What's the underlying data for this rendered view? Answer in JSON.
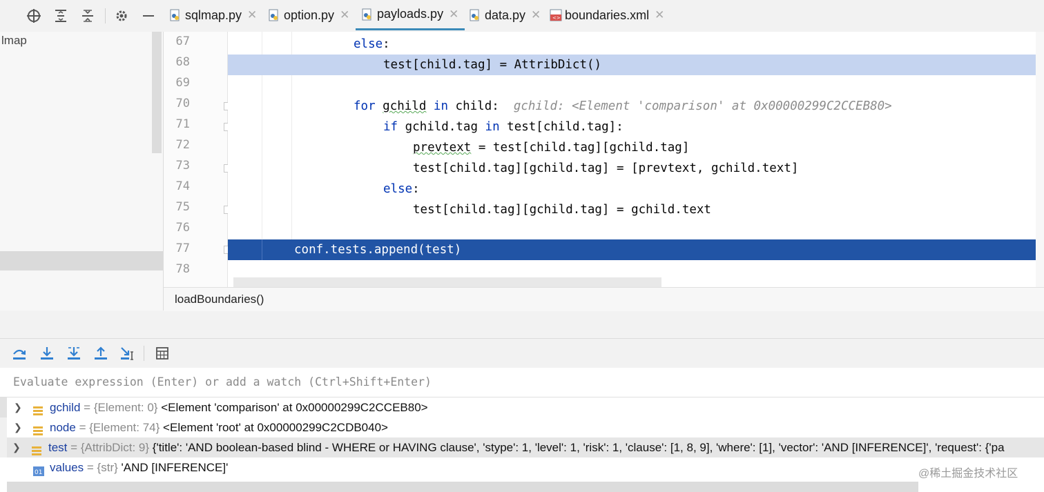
{
  "tabs": [
    {
      "label": "sqlmap.py",
      "icon": "python-file-icon",
      "active": false
    },
    {
      "label": "option.py",
      "icon": "python-file-icon",
      "active": false
    },
    {
      "label": "payloads.py",
      "icon": "python-file-icon",
      "active": true
    },
    {
      "label": "data.py",
      "icon": "python-file-icon",
      "active": false
    },
    {
      "label": "boundaries.xml",
      "icon": "xml-file-icon",
      "active": false
    }
  ],
  "project": {
    "root_label": "lmap"
  },
  "editor": {
    "lines": [
      {
        "num": "67"
      },
      {
        "num": "68"
      },
      {
        "num": "69"
      },
      {
        "num": "70"
      },
      {
        "num": "71"
      },
      {
        "num": "72"
      },
      {
        "num": "73"
      },
      {
        "num": "74"
      },
      {
        "num": "75"
      },
      {
        "num": "76"
      },
      {
        "num": "77"
      },
      {
        "num": "78"
      }
    ],
    "code": {
      "l67_kw": "else",
      "l67_rest": ":",
      "l68": "test[child.tag] = AttribDict()",
      "l70_kw1": "for",
      "l70_var": "gchild",
      "l70_kw2": "in",
      "l70_rest": "child:",
      "l70_hint": "gchild: <Element 'comparison' at 0x00000299C2CCEB80>",
      "l71_kw1": "if",
      "l71_mid": "gchild.tag",
      "l71_kw2": "in",
      "l71_rest": "test[child.tag]:",
      "l72_var": "prevtext",
      "l72_rest": " = test[child.tag][gchild.tag]",
      "l73": "test[child.tag][gchild.tag] = [prevtext, gchild.text]",
      "l74_kw": "else",
      "l74_rest": ":",
      "l75": "test[child.tag][gchild.tag] = gchild.text",
      "l77": "conf.tests.append(test)"
    }
  },
  "breadcrumb": {
    "label": "loadBoundaries()"
  },
  "debug": {
    "toolbar_icons": [
      "step-over-icon",
      "step-into-icon",
      "step-into-my-code-icon",
      "step-out-icon",
      "run-to-cursor-icon",
      "evaluate-expression-icon"
    ],
    "eval_placeholder": "Evaluate expression (Enter) or add a watch (Ctrl+Shift+Enter)"
  },
  "variables": [
    {
      "name": "gchild",
      "type": "{Element: 0}",
      "value": "<Element 'comparison' at 0x00000299C2CCEB80>",
      "icon": "object-icon",
      "expandable": true
    },
    {
      "name": "node",
      "type": "{Element: 74}",
      "value": "<Element 'root' at 0x00000299C2CDB040>",
      "icon": "object-icon",
      "expandable": true
    },
    {
      "name": "test",
      "type": "{AttribDict: 9}",
      "value": "{'title': 'AND boolean-based blind - WHERE or HAVING clause', 'stype': 1, 'level': 1, 'risk': 1, 'clause': [1, 8, 9], 'where': [1], 'vector': 'AND [INFERENCE]', 'request': {'pa",
      "icon": "object-icon",
      "expandable": true,
      "selected": true
    },
    {
      "name": "values",
      "type": "{str}",
      "value": "'AND [INFERENCE]'",
      "icon": "string-icon",
      "expandable": false
    }
  ],
  "watermark": "@稀土掘金技术社区",
  "colors": {
    "accent": "#3b8ab8",
    "exec_line": "#2154a5",
    "selected_line": "#c5d4f0",
    "keyword": "#0033b3"
  }
}
